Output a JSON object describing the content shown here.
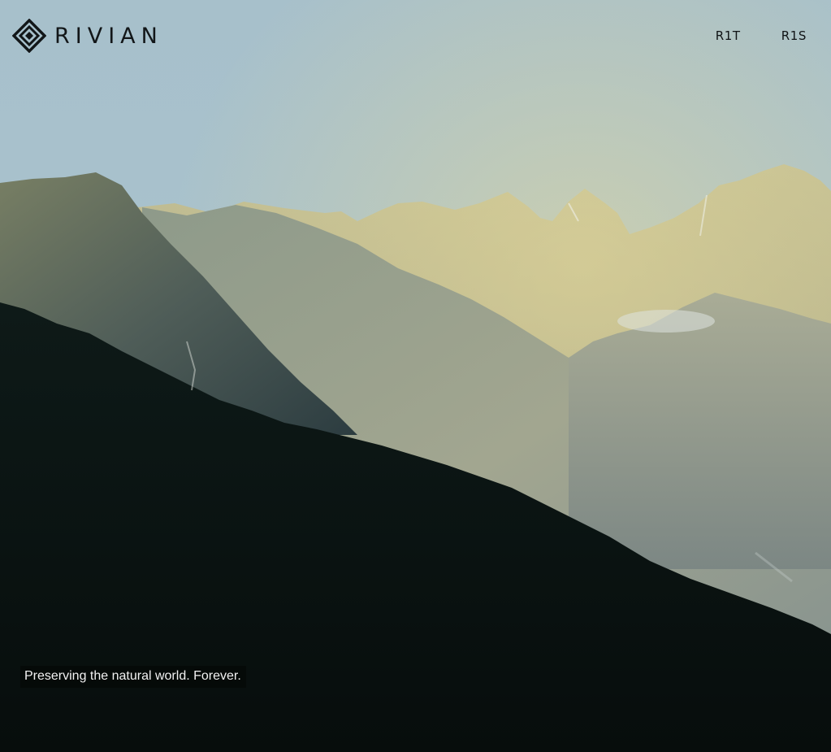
{
  "header": {
    "brand": "RIVIAN",
    "logo_icon": "rivian-compass-icon",
    "nav": [
      {
        "label": "R1T"
      },
      {
        "label": "R1S"
      }
    ]
  },
  "hero": {
    "caption": "Preserving the natural world. Forever.",
    "colors": {
      "sky": "#a8c2cd",
      "haze": "#c8c394",
      "foreground": "#0b1210"
    }
  }
}
